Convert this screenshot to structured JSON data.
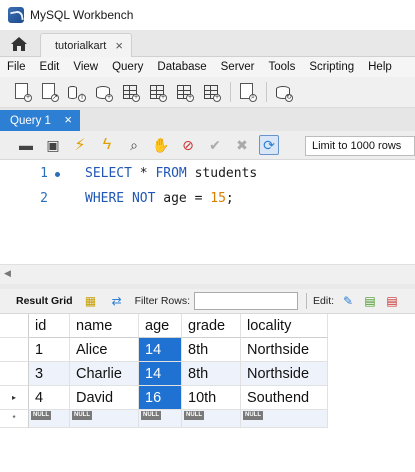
{
  "window": {
    "title": "MySQL Workbench"
  },
  "connection_tab": {
    "label": "tutorialkart",
    "close": "×"
  },
  "menu": [
    "File",
    "Edit",
    "View",
    "Query",
    "Database",
    "Server",
    "Tools",
    "Scripting",
    "Help"
  ],
  "query_tab": {
    "label": "Query 1",
    "close": "×"
  },
  "sql_toolbar": {
    "limit_label": "Limit to 1000 rows"
  },
  "editor": {
    "lines": [
      {
        "number": "1",
        "tokens": [
          "SELECT",
          " * ",
          "FROM",
          " students"
        ]
      },
      {
        "number": "2",
        "tokens": [
          "WHERE",
          " ",
          "NOT",
          " age = ",
          "15",
          ";"
        ]
      }
    ]
  },
  "result_toolbar": {
    "result_grid_label": "Result Grid",
    "filter_label": "Filter Rows:",
    "filter_value": "",
    "edit_label": "Edit:"
  },
  "result_grid": {
    "columns": [
      "id",
      "name",
      "age",
      "grade",
      "locality"
    ],
    "rows": [
      [
        "1",
        "Alice",
        "14",
        "8th",
        "Northside"
      ],
      [
        "3",
        "Charlie",
        "14",
        "8th",
        "Northside"
      ],
      [
        "4",
        "David",
        "16",
        "10th",
        "Southend"
      ]
    ],
    "current_row_marker": "▸",
    "new_row_marker": "*",
    "null_label": "NULL"
  },
  "colors": {
    "accent": "#2d7fd3",
    "selected_cell": "#1f72d1",
    "keyword": "#2057b5",
    "number": "#d68000"
  }
}
